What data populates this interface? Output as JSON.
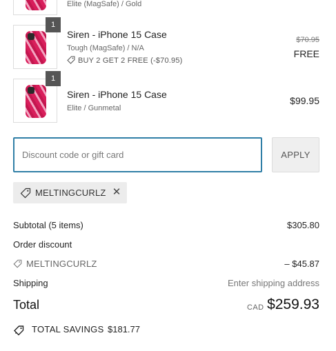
{
  "items": [
    {
      "variant": "Elite (MagSafe) / Gold"
    },
    {
      "quantity": "1",
      "title": "Siren - iPhone 15 Case",
      "variant": "Tough (MagSafe) / N/A",
      "promo": "BUY 2 GET 2 FREE (-$70.95)",
      "original_price": "$70.95",
      "price": "FREE"
    },
    {
      "quantity": "1",
      "title": "Siren - iPhone 15 Case",
      "variant": "Elite / Gunmetal",
      "price": "$99.95"
    }
  ],
  "discount": {
    "placeholder": "Discount code or gift card",
    "value": "",
    "apply_label": "APPLY",
    "applied_code": "MELTINGCURLZ"
  },
  "summary": {
    "subtotal_label": "Subtotal (5 items)",
    "subtotal_value": "$305.80",
    "order_discount_label": "Order discount",
    "discount_code": "MELTINGCURLZ",
    "discount_value": "– $45.87",
    "shipping_label": "Shipping",
    "shipping_value": "Enter shipping address",
    "total_label": "Total",
    "currency": "CAD",
    "total_value": "$259.93",
    "savings_label": "TOTAL SAVINGS",
    "savings_value": "$181.77"
  },
  "colors": {
    "accent": "#2f7ea6",
    "case_pink": "#d81e5b",
    "chip_bg": "#ececec"
  },
  "icons": [
    "tag-icon",
    "close-icon",
    "savings-tag-icon"
  ]
}
